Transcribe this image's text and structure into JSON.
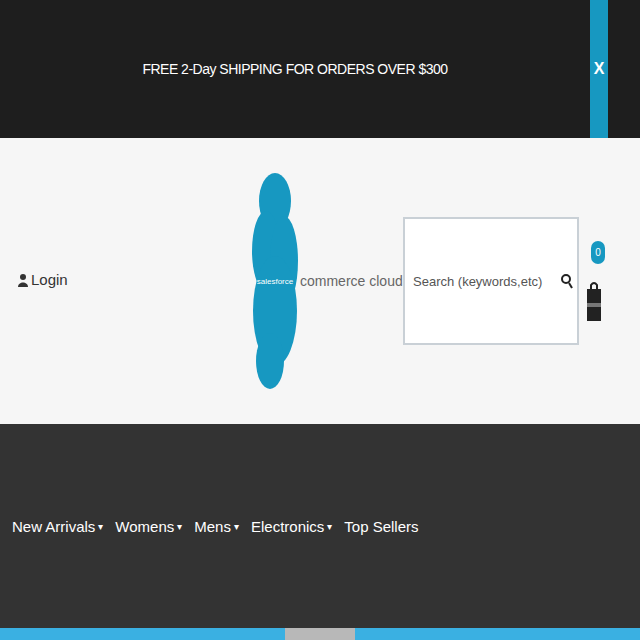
{
  "banner": {
    "text": "FREE 2-Day SHIPPING FOR ORDERS OVER $300",
    "close": "X"
  },
  "header": {
    "login": "Login",
    "logo": {
      "brand": "salesforce",
      "product": "commerce cloud"
    },
    "search": {
      "placeholder": "Search (keywords,etc)"
    },
    "cart": {
      "count": "0"
    }
  },
  "nav": {
    "caret": "▾",
    "items": [
      {
        "label": "New Arrivals",
        "dropdown": true
      },
      {
        "label": "Womens",
        "dropdown": true
      },
      {
        "label": "Mens",
        "dropdown": true
      },
      {
        "label": "Electronics",
        "dropdown": true
      },
      {
        "label": "Top Sellers",
        "dropdown": false
      }
    ]
  }
}
